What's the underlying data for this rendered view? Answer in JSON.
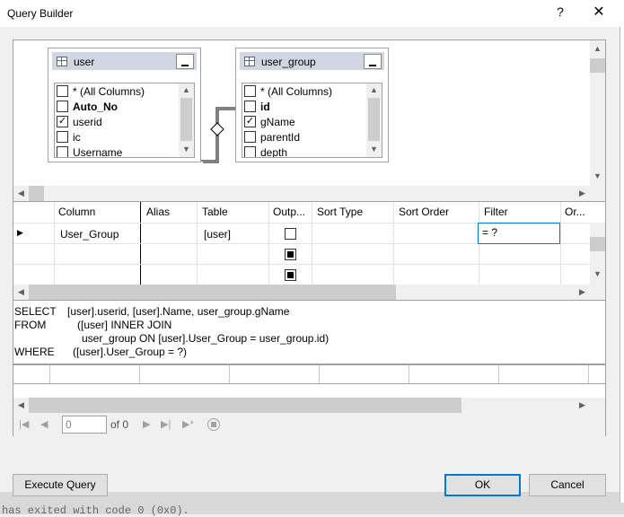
{
  "dialog": {
    "title": "Query Builder",
    "help_glyph": "?",
    "close_glyph": "✕"
  },
  "tables": [
    {
      "name": "user",
      "columns": [
        {
          "label": "* (All Columns)",
          "checked": false,
          "bold": false
        },
        {
          "label": "Auto_No",
          "checked": false,
          "bold": true
        },
        {
          "label": "userid",
          "checked": true,
          "bold": false
        },
        {
          "label": "ic",
          "checked": false,
          "bold": false
        },
        {
          "label": "Username",
          "checked": false,
          "bold": false
        }
      ]
    },
    {
      "name": "user_group",
      "columns": [
        {
          "label": "* (All Columns)",
          "checked": false,
          "bold": false
        },
        {
          "label": "id",
          "checked": false,
          "bold": true
        },
        {
          "label": "gName",
          "checked": true,
          "bold": false
        },
        {
          "label": "parentId",
          "checked": false,
          "bold": false
        },
        {
          "label": "depth",
          "checked": false,
          "bold": false
        }
      ]
    }
  ],
  "grid": {
    "headers": [
      "Column",
      "Alias",
      "Table",
      "Outp...",
      "Sort Type",
      "Sort Order",
      "Filter",
      "Or..."
    ],
    "rows": [
      {
        "column": "User_Group",
        "alias": "",
        "table": "[user]",
        "filter": "= ?"
      }
    ]
  },
  "sql": [
    {
      "kw": "SELECT",
      "text": "[user].userid, [user].Name, user_group.gName"
    },
    {
      "kw": "FROM",
      "text": "([user] INNER JOIN"
    },
    {
      "kw": "",
      "text": "user_group ON [user].User_Group = user_group.id)"
    },
    {
      "kw": "WHERE",
      "text": "([user].User_Group = ?)"
    }
  ],
  "navigator": {
    "position": "0",
    "of_text": "of 0"
  },
  "buttons": {
    "execute": "Execute Query",
    "ok": "OK",
    "cancel": "Cancel"
  },
  "background_text": "has exited with code 0 (0x0)."
}
